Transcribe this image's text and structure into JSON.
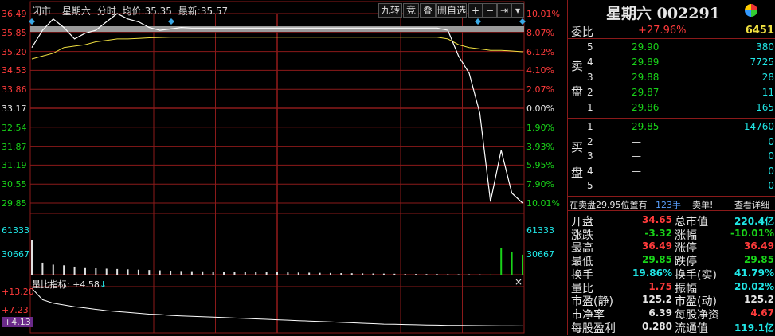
{
  "header": {
    "status": "闭市",
    "stock_name": "星期六",
    "mode": "分时",
    "avg_label": "均价:",
    "avg_value": "35.35",
    "latest_label": "最新:",
    "latest_value": "35.57",
    "buttons": [
      "九转",
      "竞",
      "叠",
      "删自选"
    ],
    "plus": "+",
    "minus": "−",
    "skip": "⇥",
    "menu": "▾"
  },
  "axis_left": [
    "36.49",
    "35.85",
    "35.20",
    "34.53",
    "33.86",
    "33.17",
    "32.54",
    "31.87",
    "31.19",
    "30.55",
    "29.85"
  ],
  "axis_right": [
    "10.01%",
    "8.07%",
    "6.12%",
    "4.10%",
    "2.07%",
    "0.00%",
    "1.90%",
    "3.93%",
    "5.95%",
    "7.90%",
    "10.01%"
  ],
  "volume_axis": {
    "left": [
      "61333",
      "30667"
    ],
    "right": [
      "61333",
      "30667"
    ]
  },
  "indicator": {
    "label": "量比指标: +4.58",
    "arrow": "↓",
    "close": "×",
    "axis": [
      "+13.20",
      "+7.23",
      "+4.13"
    ]
  },
  "colors": {
    "up": "#ff3b3b",
    "down": "#19d319",
    "grid": "#8b1a1a",
    "price": "#ffffff",
    "avg": "#f0e040"
  },
  "chart_data": {
    "type": "line",
    "prev_close": 33.17,
    "ylim": [
      29.85,
      36.49
    ],
    "series": [
      {
        "values": [
          35.3,
          35.9,
          36.3,
          36.0,
          35.6,
          35.8,
          35.9,
          36.2,
          36.49,
          36.3,
          36.2,
          36.0,
          35.9,
          35.95,
          36.0,
          35.98,
          35.98,
          35.98,
          35.98,
          35.98,
          35.98,
          35.98,
          35.98,
          35.98,
          35.98,
          35.98,
          35.98,
          35.98,
          35.98,
          35.98,
          35.98,
          35.98,
          35.98,
          35.98,
          35.98,
          35.98,
          35.98,
          35.98,
          35.98,
          35.9,
          35.0,
          34.4,
          33.0,
          29.9,
          31.7,
          30.2,
          29.85
        ]
      },
      {
        "values": [
          34.9,
          35.0,
          35.1,
          35.3,
          35.35,
          35.4,
          35.5,
          35.55,
          35.6,
          35.6,
          35.62,
          35.64,
          35.65,
          35.66,
          35.66,
          35.66,
          35.66,
          35.66,
          35.66,
          35.66,
          35.66,
          35.66,
          35.66,
          35.66,
          35.66,
          35.66,
          35.66,
          35.66,
          35.66,
          35.66,
          35.66,
          35.66,
          35.66,
          35.66,
          35.66,
          35.66,
          35.66,
          35.66,
          35.66,
          35.6,
          35.4,
          35.3,
          35.25,
          35.2,
          35.2,
          35.18,
          35.15
        ]
      }
    ],
    "volume": [
      52000,
      18000,
      15000,
      14000,
      12000,
      11000,
      10000,
      9000,
      8500,
      8000,
      7500,
      7000,
      6500,
      6000,
      5500,
      5200,
      5000,
      4800,
      4600,
      4400,
      4200,
      4000,
      3800,
      3600,
      3400,
      3200,
      3000,
      2800,
      2600,
      2400,
      2200,
      2000,
      1800,
      1600,
      1400,
      1200,
      1000,
      900,
      800,
      700,
      600,
      500,
      400,
      300,
      40000,
      34000,
      30000
    ],
    "ratio": [
      13.2,
      10.6,
      9.8,
      9.4,
      9.0,
      8.7,
      8.4,
      8.1,
      7.9,
      7.7,
      7.5,
      7.3,
      7.2,
      7.0,
      6.9,
      6.8,
      6.7,
      6.6,
      6.5,
      6.4,
      6.3,
      6.2,
      6.1,
      6.0,
      5.9,
      5.8,
      5.7,
      5.6,
      5.5,
      5.4,
      5.3,
      5.2,
      5.1,
      5.0,
      4.95,
      4.9,
      4.85,
      4.8,
      4.75,
      4.7,
      4.68,
      4.66,
      4.64,
      4.62,
      4.6,
      4.59,
      4.58
    ]
  },
  "panel": {
    "title": "星期六 002291",
    "weibi_label": "委比",
    "weibi_pct": "+27.96%",
    "weibi_num": "6451",
    "sell_label": [
      "卖",
      "盘"
    ],
    "sell": [
      {
        "lvl": "5",
        "price": "29.90",
        "vol": "380"
      },
      {
        "lvl": "4",
        "price": "29.89",
        "vol": "7725"
      },
      {
        "lvl": "3",
        "price": "29.88",
        "vol": "28"
      },
      {
        "lvl": "2",
        "price": "29.87",
        "vol": "11"
      },
      {
        "lvl": "1",
        "price": "29.86",
        "vol": "165"
      }
    ],
    "buy_label": [
      "买",
      "盘"
    ],
    "buy": [
      {
        "lvl": "1",
        "price": "29.85",
        "vol": "14760"
      },
      {
        "lvl": "2",
        "price": "—",
        "vol": "0"
      },
      {
        "lvl": "3",
        "price": "—",
        "vol": "0"
      },
      {
        "lvl": "4",
        "price": "—",
        "vol": "0"
      },
      {
        "lvl": "5",
        "price": "—",
        "vol": "0"
      }
    ],
    "notice": {
      "text": "在卖盘29.95位置有",
      "qty": "123手",
      "action": "卖单!",
      "link": "查看详细"
    },
    "stats_left": [
      {
        "label": "开盘",
        "value": "34.65",
        "color": "red"
      },
      {
        "label": "涨跌",
        "value": "-3.32",
        "color": "green"
      },
      {
        "label": "最高",
        "value": "36.49",
        "color": "red"
      },
      {
        "label": "最低",
        "value": "29.85",
        "color": "green"
      },
      {
        "label": "换手",
        "value": "19.86%",
        "color": "cyan"
      },
      {
        "label": "量比",
        "value": "1.75",
        "color": "red"
      },
      {
        "label": "市盈(静)",
        "value": "125.2",
        "color": "white"
      },
      {
        "label": "市净率",
        "value": "6.39",
        "color": "white"
      },
      {
        "label": "每股盈利",
        "value": "0.280",
        "color": "white"
      }
    ],
    "stats_right": [
      {
        "label": "总市值",
        "value": "220.4亿",
        "color": "cyan"
      },
      {
        "label": "涨幅",
        "value": "-10.01%",
        "color": "green"
      },
      {
        "label": "涨停",
        "value": "36.49",
        "color": "red"
      },
      {
        "label": "跌停",
        "value": "29.85",
        "color": "green"
      },
      {
        "label": "换手(实)",
        "value": "41.79%",
        "color": "cyan"
      },
      {
        "label": "振幅",
        "value": "20.02%",
        "color": "cyan"
      },
      {
        "label": "市盈(动)",
        "value": "125.2",
        "color": "white"
      },
      {
        "label": "每股净资",
        "value": "4.67",
        "color": "red"
      },
      {
        "label": "流通值",
        "value": "119.1亿",
        "color": "cyan"
      }
    ]
  }
}
